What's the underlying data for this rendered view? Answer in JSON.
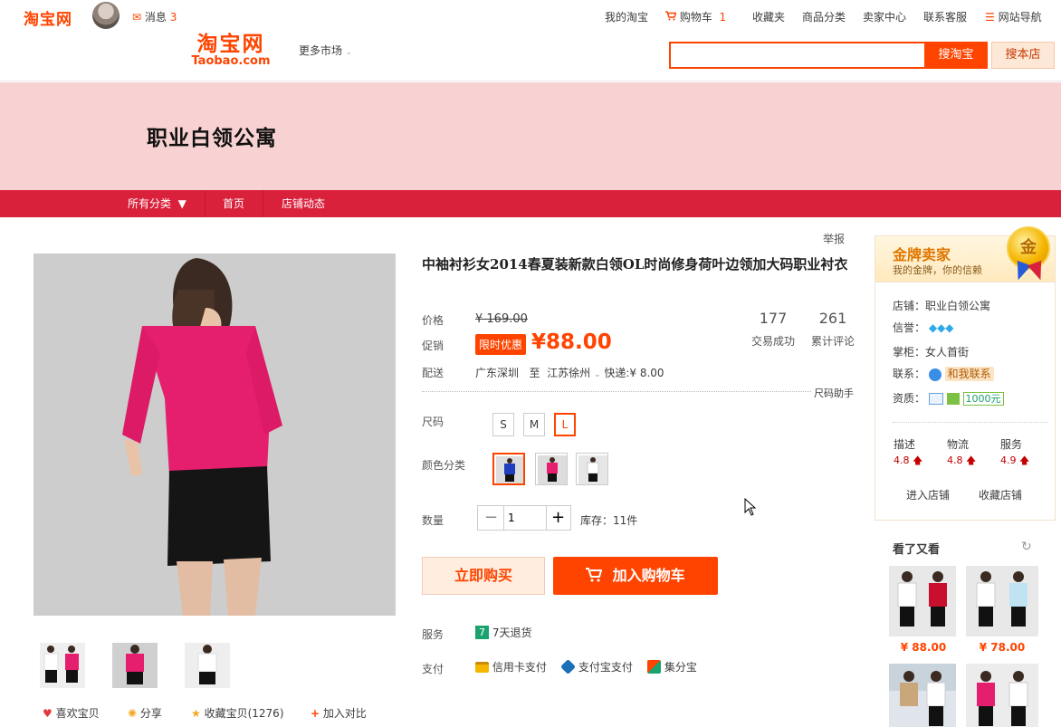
{
  "topbar": {
    "logo": "淘宝网",
    "messages_label": "消息",
    "messages_count": "3",
    "my_taobao": "我的淘宝",
    "cart_label": "购物车",
    "cart_count": "1",
    "favorites": "收藏夹",
    "categories": "商品分类",
    "seller_center": "卖家中心",
    "contact_service": "联系客服",
    "site_nav": "网站导航"
  },
  "header": {
    "logo_cn": "淘宝网",
    "logo_en": "Taobao.com",
    "more_markets": "更多市场",
    "search_placeholder": "",
    "search_button": "搜淘宝",
    "search_shop_button": "搜本店"
  },
  "shop": {
    "title": "职业白领公寓",
    "nav": [
      "所有分类",
      "首页",
      "店铺动态"
    ]
  },
  "product": {
    "report": "举报",
    "title": "中袖衬衫女2014春夏装新款白领OL时尚修身荷叶边领加大码职业衬衣",
    "price_label": "价格",
    "price_old": "¥ 169.00",
    "promo_label": "促销",
    "promo_tag": "限时优惠",
    "promo_price": "¥88.00",
    "deals_count": "177",
    "deals_label": "交易成功",
    "reviews_count": "261",
    "reviews_label": "累计评论",
    "ship_label": "配送",
    "ship_from": "广东深圳",
    "ship_to_word": "至",
    "ship_to": "江苏徐州",
    "ship_fee": "快递:¥ 8.00",
    "size_helper": "尺码助手",
    "size_label": "尺码",
    "sizes": [
      "S",
      "M",
      "L"
    ],
    "selected_size": "L",
    "color_label": "颜色分类",
    "colors": [
      "blue",
      "pink",
      "white"
    ],
    "qty_label": "数量",
    "qty_value": "1",
    "stock": "库存：11件",
    "buy_now": "立即购买",
    "add_to_cart": "加入购物车",
    "service_label": "服务",
    "service_item": "7天退货",
    "pay_label": "支付",
    "pay_methods": [
      "信用卡支付",
      "支付宝支付",
      "集分宝"
    ],
    "footer_actions": [
      "喜欢宝贝",
      "分享",
      "收藏宝贝(1276)",
      "加入对比"
    ]
  },
  "seller": {
    "gold_title": "金牌卖家",
    "gold_sub": "我的金牌，你的信赖",
    "medal": "金",
    "shop_row": "店铺：职业白领公寓",
    "credit_label": "信誉：",
    "owner_row": "掌柜：女人首街",
    "contact_label": "联系：",
    "contact_badge": "和我联系",
    "qual_label": "资质：",
    "qual_badge": "1000元",
    "scores": [
      {
        "label": "描述",
        "value": "4.8"
      },
      {
        "label": "物流",
        "value": "4.8"
      },
      {
        "label": "服务",
        "value": "4.9"
      }
    ],
    "enter_shop": "进入店铺",
    "fav_shop": "收藏店铺"
  },
  "recommend": {
    "title": "看了又看",
    "prices": [
      "¥ 88.00",
      "¥ 78.00"
    ]
  },
  "colors": {
    "brand": "#ff4400",
    "shop_nav": "#d9213b",
    "banner": "#f8d2d2"
  }
}
